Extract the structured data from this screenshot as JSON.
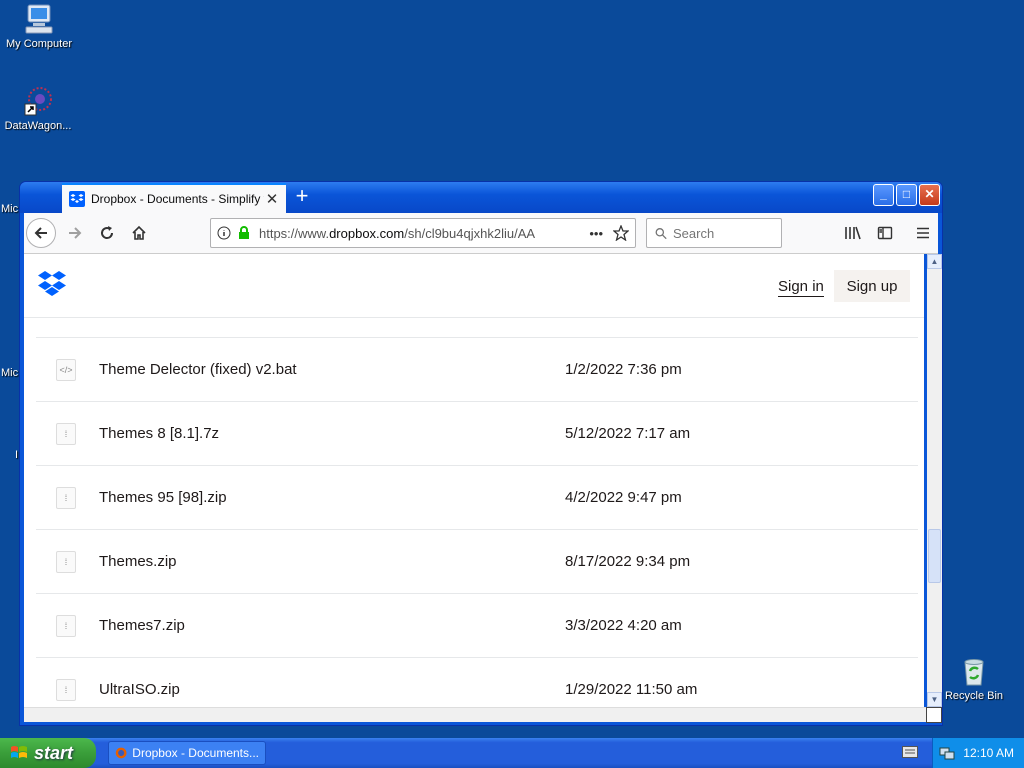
{
  "desktop": {
    "icons": [
      {
        "label": "My Computer"
      },
      {
        "label": "DataWagon..."
      },
      {
        "label": "Recycle Bin"
      }
    ],
    "partial_labels": [
      "Mic",
      "Mic",
      "I"
    ]
  },
  "browser": {
    "tab_title": "Dropbox - Documents - Simplify yo",
    "url_prefix": "https://www.",
    "url_domain": "dropbox.com",
    "url_rest": "/sh/cl9bu4qjxhk2liu/AA",
    "url_more": "•••",
    "search_placeholder": "Search",
    "window_controls": {
      "minimize": "_",
      "maximize": "□",
      "close": "✕"
    }
  },
  "page": {
    "header": {
      "sign_in": "Sign in",
      "sign_up": "Sign up"
    },
    "files": [
      {
        "name": "Theme Delector (fixed) v2.bat",
        "date": "1/2/2022 7:36 pm",
        "icon": "code-file-icon"
      },
      {
        "name": "Themes 8 [8.1].7z",
        "date": "5/12/2022 7:17 am",
        "icon": "zip-file-icon"
      },
      {
        "name": "Themes 95 [98].zip",
        "date": "4/2/2022 9:47 pm",
        "icon": "zip-file-icon"
      },
      {
        "name": "Themes.zip",
        "date": "8/17/2022 9:34 pm",
        "icon": "zip-file-icon"
      },
      {
        "name": "Themes7.zip",
        "date": "3/3/2022 4:20 am",
        "icon": "zip-file-icon"
      },
      {
        "name": "UltraISO.zip",
        "date": "1/29/2022 11:50 am",
        "icon": "zip-file-icon"
      }
    ]
  },
  "taskbar": {
    "start_label": "start",
    "task_label": "Dropbox - Documents...",
    "clock": "12:10 AM"
  },
  "colors": {
    "desktop": "#0a4a9a",
    "dropbox_blue": "#0061fe",
    "accent_tab": "#0a84ff"
  }
}
